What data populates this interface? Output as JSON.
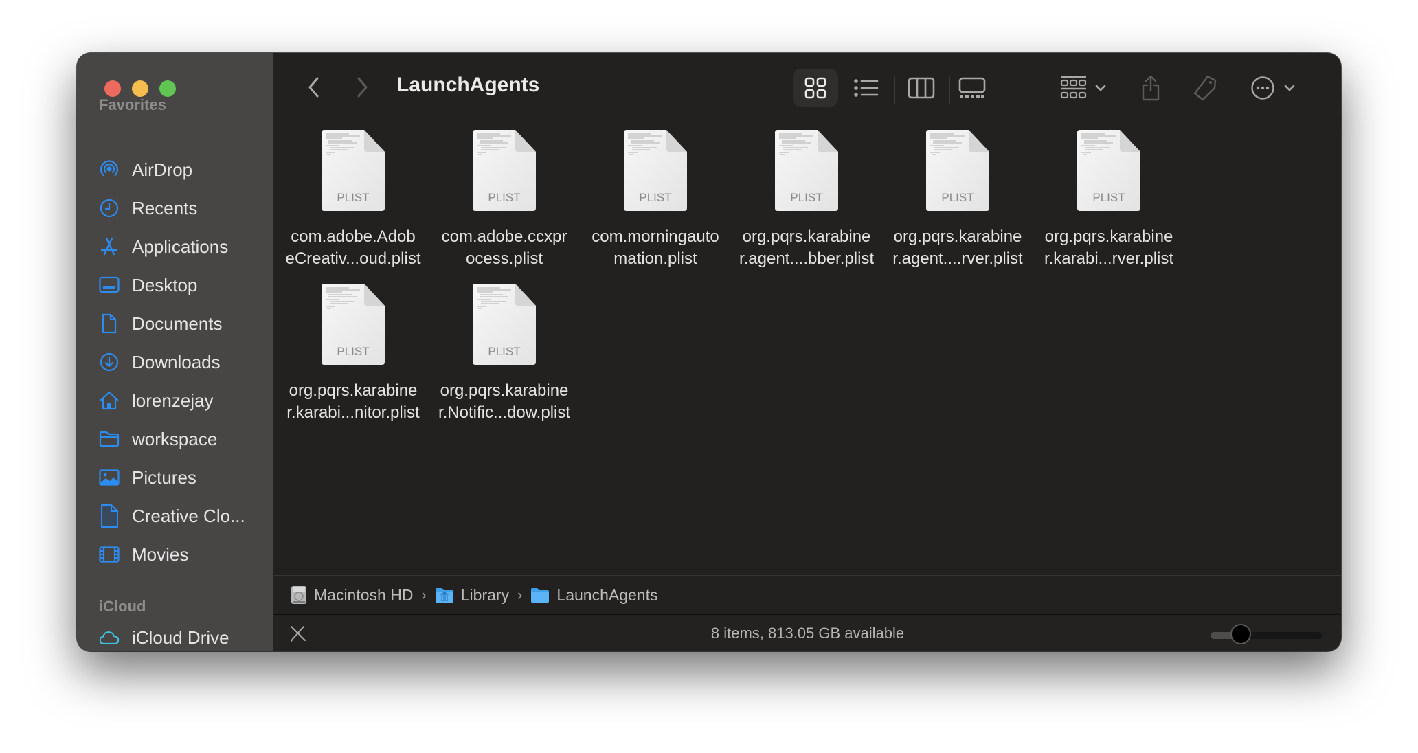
{
  "window": {
    "title": "LaunchAgents"
  },
  "sidebar": {
    "favorites_header": "Favorites",
    "favorites": [
      {
        "label": "AirDrop",
        "icon": "airdrop-icon"
      },
      {
        "label": "Recents",
        "icon": "clock-icon"
      },
      {
        "label": "Applications",
        "icon": "applications-icon"
      },
      {
        "label": "Desktop",
        "icon": "desktop-icon"
      },
      {
        "label": "Documents",
        "icon": "document-icon"
      },
      {
        "label": "Downloads",
        "icon": "download-icon"
      },
      {
        "label": "lorenzejay",
        "icon": "home-icon"
      },
      {
        "label": "workspace",
        "icon": "folder-icon"
      },
      {
        "label": "Pictures",
        "icon": "pictures-icon"
      },
      {
        "label": "Creative Clo...",
        "icon": "file-icon"
      },
      {
        "label": "Movies",
        "icon": "film-icon"
      }
    ],
    "icloud_header": "iCloud",
    "icloud": [
      {
        "label": "iCloud Drive",
        "icon": "cloud-icon"
      }
    ],
    "accent_color": "#2d8cf0"
  },
  "toolbar": {
    "back": "back-chevron-icon",
    "forward": "forward-chevron-icon",
    "views": [
      "icon-view",
      "list-view",
      "column-view",
      "gallery-view"
    ],
    "active_view": "icon-view",
    "group": "group-by-icon",
    "share": "share-icon",
    "tag": "tag-icon",
    "more": "more-actions-icon",
    "search": "search-icon"
  },
  "files": [
    {
      "line1": "com.adobe.Adob",
      "line2": "eCreativ...oud.plist",
      "type": "PLIST"
    },
    {
      "line1": "com.adobe.ccxpr",
      "line2": "ocess.plist",
      "type": "PLIST"
    },
    {
      "line1": "com.morningauto",
      "line2": "mation.plist",
      "type": "PLIST"
    },
    {
      "line1": "org.pqrs.karabine",
      "line2": "r.agent....bber.plist",
      "type": "PLIST"
    },
    {
      "line1": "org.pqrs.karabine",
      "line2": "r.agent....rver.plist",
      "type": "PLIST"
    },
    {
      "line1": "org.pqrs.karabine",
      "line2": "r.karabi...rver.plist",
      "type": "PLIST"
    },
    {
      "line1": "org.pqrs.karabine",
      "line2": "r.karabi...nitor.plist",
      "type": "PLIST"
    },
    {
      "line1": "org.pqrs.karabine",
      "line2": "r.Notific...dow.plist",
      "type": "PLIST"
    }
  ],
  "pathbar": [
    {
      "label": "Macintosh HD",
      "icon": "hard-drive-icon"
    },
    {
      "label": "Library",
      "icon": "library-folder-icon"
    },
    {
      "label": "LaunchAgents",
      "icon": "folder-icon"
    }
  ],
  "pathbar_separator": "›",
  "status": {
    "text": "8 items, 813.05 GB available",
    "icon_size_slider": 0.27
  }
}
